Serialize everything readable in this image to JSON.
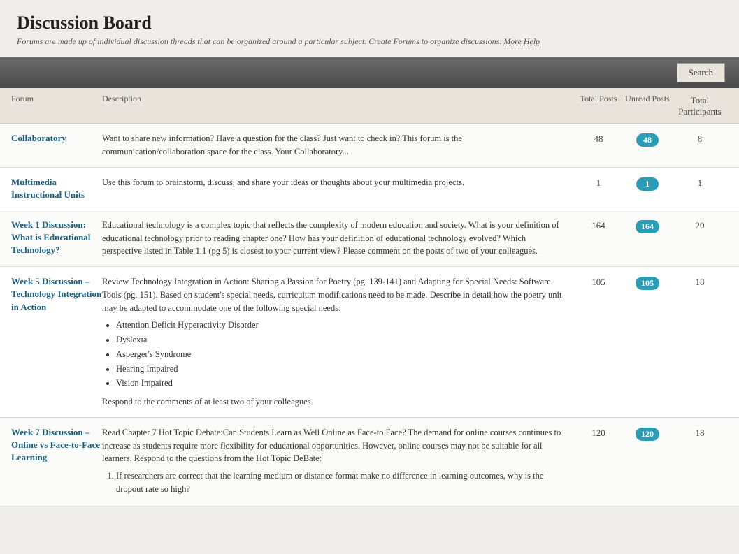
{
  "header": {
    "title": "Discussion Board",
    "subtitle": "Forums are made up of individual discussion threads that can be organized around a particular subject. Create Forums to organize discussions.",
    "more_help_label": "More Help"
  },
  "toolbar": {
    "search_label": "Search"
  },
  "table": {
    "columns": {
      "forum": "Forum",
      "description": "Description",
      "total_posts": "Total Posts",
      "unread_posts": "Unread Posts",
      "total_participants": "Total Participants"
    },
    "rows": [
      {
        "name": "Collaboratory",
        "description": "Want to share new information? Have a question for the class? Just want to check in? This forum is the communication/collaboration space for the class. Your Collaboratory...",
        "total_posts": 48,
        "unread_posts": 48,
        "total_participants": 8,
        "has_list": false
      },
      {
        "name": "Multimedia Instructional Units",
        "description": "Use this forum to brainstorm, discuss, and share your ideas or thoughts about your multimedia projects.",
        "total_posts": 1,
        "unread_posts": 1,
        "total_participants": 1,
        "has_list": false
      },
      {
        "name": "Week 1 Discussion: What is Educational Technology?",
        "description": "Educational technology is a complex topic that reflects the complexity of modern education and society. What is your definition of educational technology prior to reading chapter one?  How has your definition of educational technology evolved?  Which perspective listed in Table 1.1 (pg 5) is closest to your current view?  Please comment on the posts of two of your colleagues.",
        "total_posts": 164,
        "unread_posts": 164,
        "total_participants": 20,
        "has_list": false
      },
      {
        "name": "Week 5 Discussion – Technology Integration in Action",
        "description": "Review Technology Integration in Action: Sharing a Passion for Poetry (pg. 139-141) and Adapting for Special Needs: Software Tools (pg. 151). Based on student's special needs, curriculum modifications need to be made. Describe in detail how the poetry unit may be adapted to accommodate one of the following special needs:",
        "total_posts": 105,
        "unread_posts": 105,
        "total_participants": 18,
        "has_list": true,
        "list_items": [
          "Attention Deficit Hyperactivity Disorder",
          "Dyslexia",
          "Asperger's Syndrome",
          "Hearing Impaired",
          "Vision Impaired"
        ],
        "list_footer": "Respond to the comments of at least two of your colleagues."
      },
      {
        "name": "Week 7 Discussion – Online vs Face-to-Face Learning",
        "description": "Read Chapter 7 Hot Topic Debate:Can Students Learn as Well Online as Face-to Face? The demand for online courses continues to increase as students require more flexibility for educational opportunities. However, online courses may not be suitable for all learners.  Respond to the questions from the Hot Topic DeBate:",
        "total_posts": 120,
        "unread_posts": 120,
        "total_participants": 18,
        "has_list": false,
        "has_numbered_list": true,
        "numbered_list_items": [
          "If researchers are correct that the learning medium or distance format make no difference in learning outcomes, why is the dropout rate so high?"
        ]
      }
    ]
  }
}
